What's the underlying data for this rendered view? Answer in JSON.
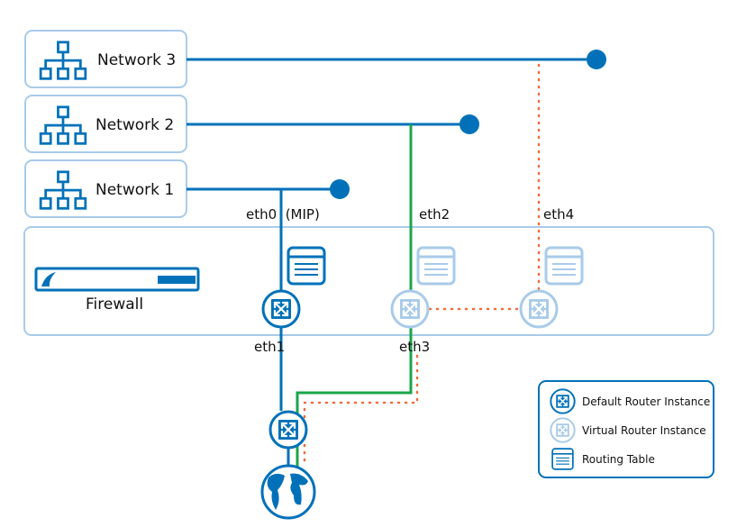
{
  "colors": {
    "default_router": "#0071b9",
    "virtual_router": "#a9cbe9",
    "green_route": "#1aa64a",
    "orange_route": "#f26b3a",
    "box_border": "#a9cbe9"
  },
  "networks": [
    {
      "label": "Network 3",
      "icon": "network-topology-icon"
    },
    {
      "label": "Network 2",
      "icon": "network-topology-icon"
    },
    {
      "label": "Network 1",
      "icon": "network-topology-icon"
    }
  ],
  "firewall": {
    "label": "Firewall",
    "icon": "firewall-appliance-icon"
  },
  "interfaces": {
    "eth0": "eth0  (MIP)",
    "eth1": "eth1",
    "eth2": "eth2",
    "eth3": "eth3",
    "eth4": "eth4"
  },
  "legend": {
    "default_router": "Default Router Instance",
    "virtual_router": "Virtual Router Instance",
    "routing_table": "Routing Table"
  },
  "icons": {
    "router": "router-arrows-icon",
    "routing_table": "routing-table-icon",
    "internet": "globe-icon"
  }
}
